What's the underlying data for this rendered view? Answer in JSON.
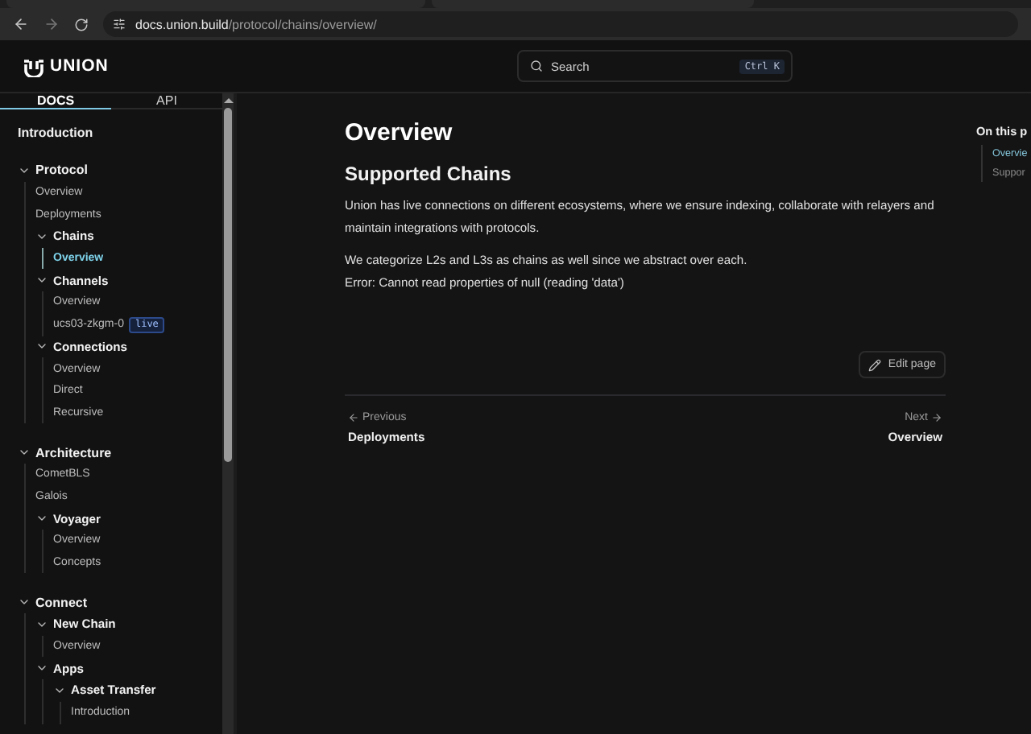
{
  "browser": {
    "url_domain": "docs.union.build",
    "url_path": "/protocol/chains/overview/"
  },
  "header": {
    "logo": "UNION",
    "search": {
      "placeholder": "Search",
      "shortcut": "Ctrl K"
    }
  },
  "sidebar": {
    "tabs": [
      {
        "label": "DOCS",
        "selected": true
      },
      {
        "label": "API",
        "selected": false
      }
    ],
    "intro": {
      "label": "Introduction",
      "selected": false
    },
    "sections": [
      {
        "label": "Protocol",
        "expanded": true,
        "children": [
          {
            "label": "Overview",
            "selected": false
          },
          {
            "label": "Deployments",
            "selected": false
          },
          {
            "label": "Chains",
            "expanded": true,
            "children": [
              {
                "label": "Overview",
                "selected": true
              }
            ]
          },
          {
            "label": "Channels",
            "expanded": true,
            "children": [
              {
                "label": "Overview",
                "selected": false
              },
              {
                "label": "ucs03-zkgm-0",
                "badge": "live",
                "selected": false
              }
            ]
          },
          {
            "label": "Connections",
            "expanded": true,
            "children": [
              {
                "label": "Overview",
                "selected": false
              },
              {
                "label": "Direct",
                "selected": false
              },
              {
                "label": "Recursive",
                "selected": false
              }
            ]
          }
        ]
      },
      {
        "label": "Architecture",
        "expanded": true,
        "children": [
          {
            "label": "CometBLS",
            "selected": false
          },
          {
            "label": "Galois",
            "selected": false
          },
          {
            "label": "Voyager",
            "expanded": true,
            "children": [
              {
                "label": "Overview",
                "selected": false
              },
              {
                "label": "Concepts",
                "selected": false
              }
            ]
          }
        ]
      },
      {
        "label": "Connect",
        "expanded": true,
        "children": [
          {
            "label": "New Chain",
            "expanded": true,
            "children": [
              {
                "label": "Overview",
                "selected": false
              }
            ]
          },
          {
            "label": "Apps",
            "expanded": true,
            "children": [
              {
                "label": "Asset Transfer",
                "expanded": true,
                "children": [
                  {
                    "label": "Introduction",
                    "selected": false
                  }
                ]
              }
            ]
          }
        ]
      }
    ]
  },
  "article": {
    "title": "Overview",
    "heading": "Supported Chains",
    "paragraphs": [
      "Union has live connections on different ecosystems, where we ensure indexing, collaborate with relayers and maintain integrations with protocols.",
      "We categorize L2s and L3s as chains as well since we abstract over each.\nError: Cannot read properties of null (reading 'data')"
    ],
    "edit_button": "Edit page",
    "pagination": {
      "previous": {
        "hint": "Previous",
        "title": "Deployments"
      },
      "next": {
        "hint": "Next",
        "title": "Overview"
      }
    }
  },
  "toc": {
    "title": "On this p",
    "items": [
      {
        "label": "Overvie",
        "selected": true
      },
      {
        "label": "Suppor",
        "selected": false
      }
    ]
  }
}
